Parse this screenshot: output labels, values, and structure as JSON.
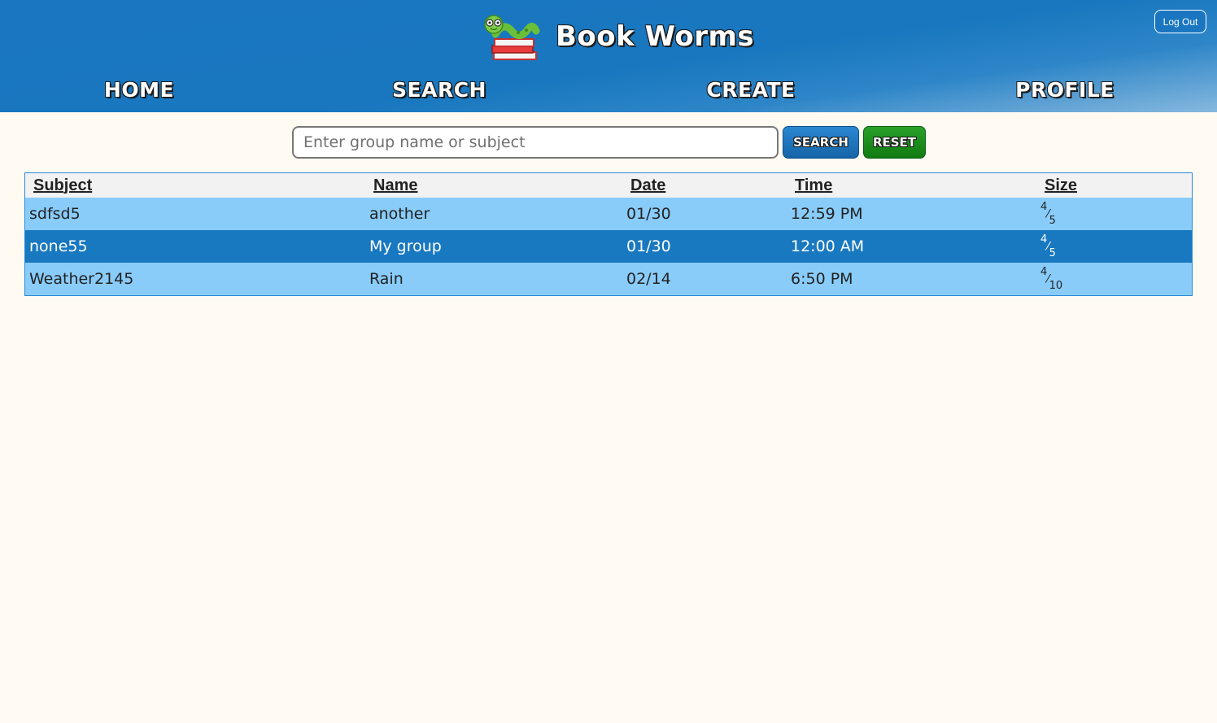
{
  "header": {
    "brand_title": "Book Worms",
    "logout_label": "Log Out",
    "nav": [
      "HOME",
      "SEARCH",
      "CREATE",
      "PROFILE"
    ]
  },
  "search": {
    "placeholder": "Enter group name or subject",
    "value": "",
    "search_label": "SEARCH",
    "reset_label": "RESET"
  },
  "table": {
    "columns": [
      "Subject",
      "Name",
      "Date",
      "Time",
      "Size"
    ],
    "rows": [
      {
        "subject": "sdfsd5",
        "name": "another",
        "date": "01/30",
        "time": "12:59 PM",
        "size_num": "4",
        "size_den": "5",
        "selected": false
      },
      {
        "subject": "none55",
        "name": "My group",
        "date": "01/30",
        "time": "12:00 AM",
        "size_num": "4",
        "size_den": "5",
        "selected": true
      },
      {
        "subject": "Weather2145",
        "name": "Rain",
        "date": "02/14",
        "time": "6:50 PM",
        "size_num": "4",
        "size_den": "10",
        "selected": false
      }
    ]
  },
  "colors": {
    "header_blue": "#1a76c0",
    "row_light": "#89ccfa",
    "row_selected": "#1878c0",
    "reset_green": "#1a8f1a",
    "page_bg": "#fffaf2"
  },
  "icons": {
    "logo": "bookworm-logo-icon"
  }
}
